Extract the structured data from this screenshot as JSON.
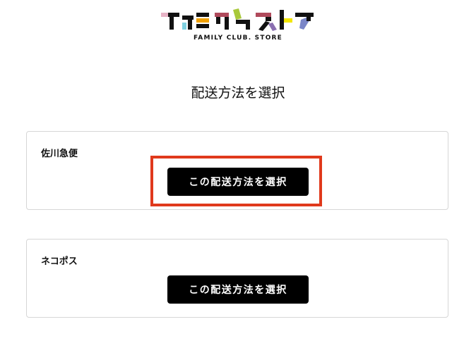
{
  "header": {
    "logo_text": "ファミクラストア",
    "logo_subtitle": "FAMILY CLUB. STORE"
  },
  "page_title": "配送方法を選択",
  "shipping_options": [
    {
      "name": "佐川急便",
      "button_label": "この配送方法を選択"
    },
    {
      "name": "ネコポス",
      "button_label": "この配送方法を選択"
    }
  ],
  "highlight": {
    "color": "#e0391c"
  },
  "colors": {
    "button_bg": "#000000",
    "button_text": "#ffffff",
    "card_border": "#d6d6d6",
    "logo_pink": "#e7b3c6",
    "logo_teal": "#7fd0e0",
    "logo_orange": "#f0a000",
    "logo_maroon": "#b04a5c",
    "logo_green": "#a8c83a",
    "logo_purple": "#8a6fb0",
    "logo_yellow": "#f3e600",
    "logo_blue": "#7a86c8"
  }
}
